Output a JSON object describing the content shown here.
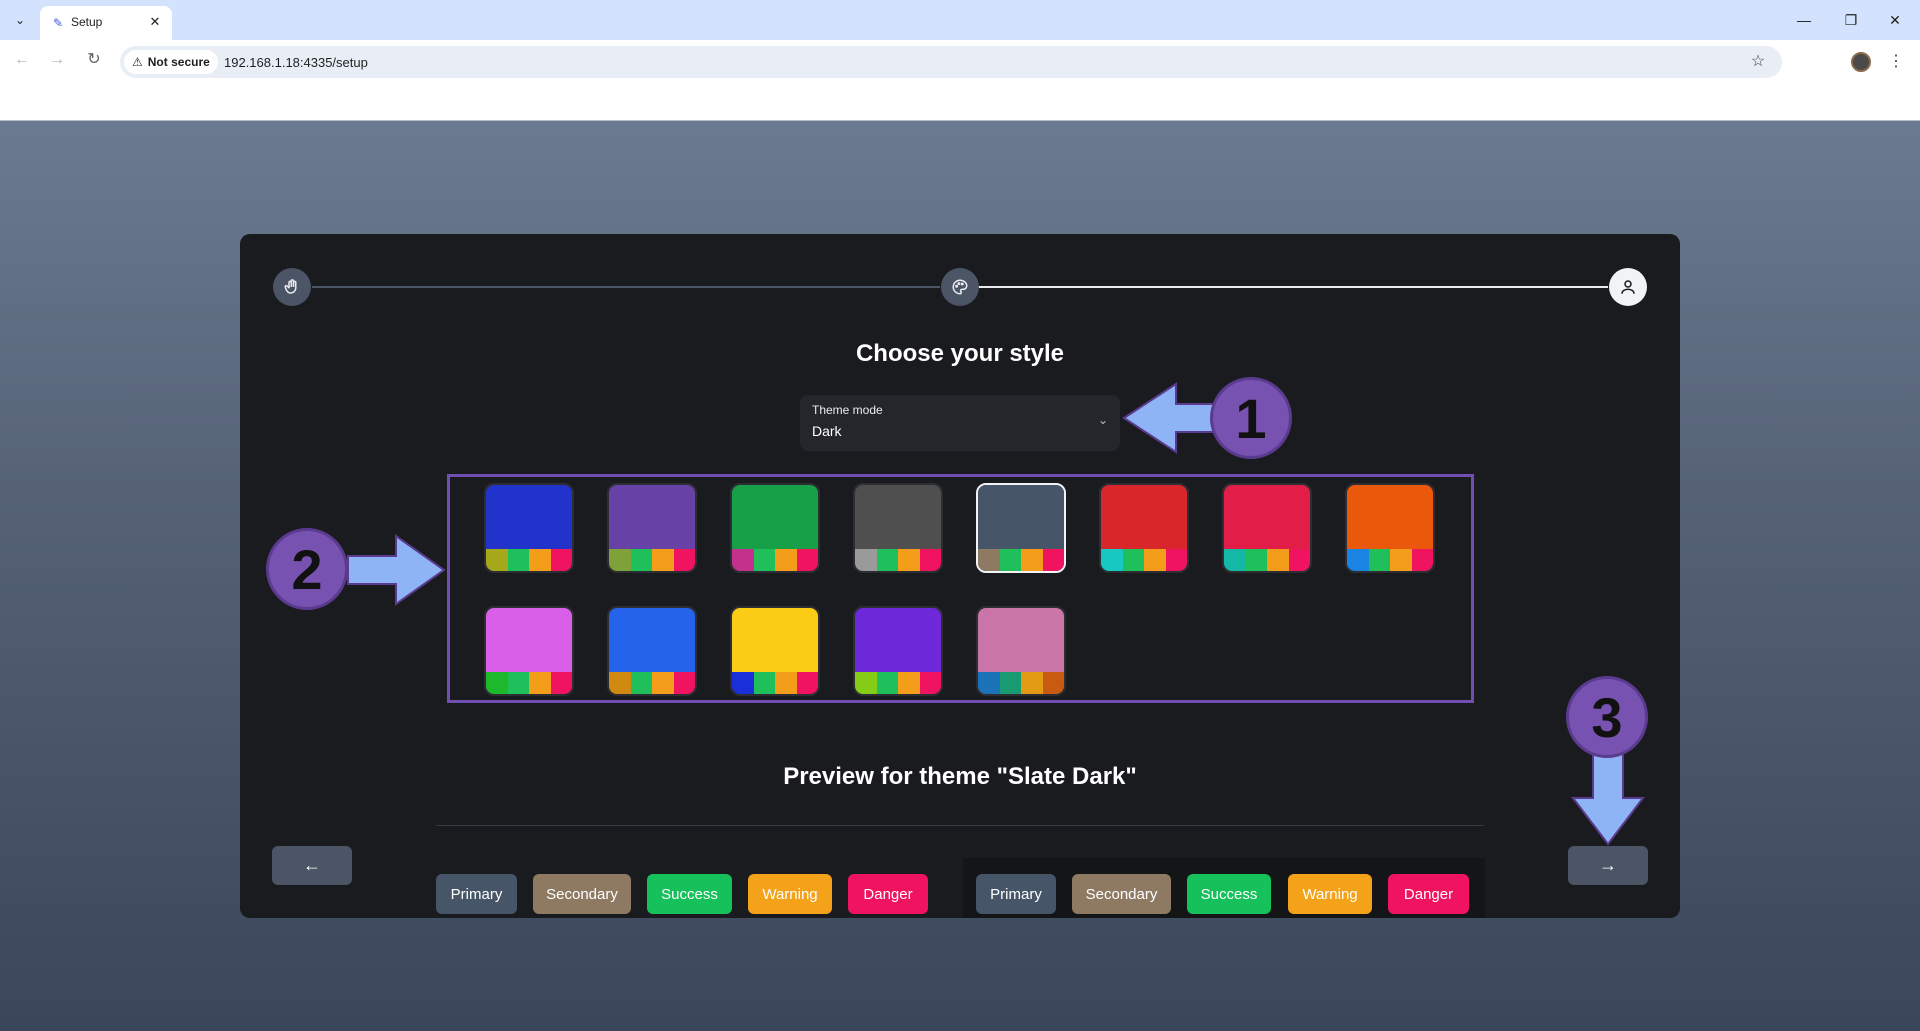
{
  "browser": {
    "tab_title": "Setup",
    "tab_close": "✕",
    "security_label": "Not secure",
    "url": "192.168.1.18:4335/setup",
    "window_controls": {
      "minimize": "—",
      "restore": "❐",
      "close": "✕"
    }
  },
  "page": {
    "title": "Choose your style",
    "theme_select": {
      "label": "Theme mode",
      "value": "Dark"
    },
    "preview_title": "Preview for theme \"Slate Dark\"",
    "back_arrow": "←",
    "next_arrow": "→",
    "steps": [
      {
        "icon": "wave-icon",
        "state": "done"
      },
      {
        "icon": "palette-icon",
        "state": "active"
      },
      {
        "icon": "user-icon",
        "state": "pending"
      }
    ],
    "swatches": [
      {
        "name": "blue-dark",
        "main": "#2233cc",
        "stripes": [
          "#a5a81a",
          "#1fbf5b",
          "#f39d1a",
          "#f0135f"
        ]
      },
      {
        "name": "violet",
        "main": "#6741a6",
        "stripes": [
          "#7ea13a",
          "#1fbf5b",
          "#f39d1a",
          "#f0135f"
        ]
      },
      {
        "name": "green",
        "main": "#18a049",
        "stripes": [
          "#c4318c",
          "#1fbf5b",
          "#f39d1a",
          "#f0135f"
        ]
      },
      {
        "name": "gray",
        "main": "#4f4f4f",
        "stripes": [
          "#9a9a9a",
          "#1fbf5b",
          "#f39d1a",
          "#f0135f"
        ]
      },
      {
        "name": "slate",
        "main": "#475569",
        "stripes": [
          "#8e7a62",
          "#1fbf5b",
          "#f39d1a",
          "#f0135f"
        ],
        "selected": true
      },
      {
        "name": "red",
        "main": "#d9262a",
        "stripes": [
          "#16c7c2",
          "#1fbf5b",
          "#f39d1a",
          "#f0135f"
        ]
      },
      {
        "name": "crimson",
        "main": "#e11d48",
        "stripes": [
          "#14b8a6",
          "#1fbf5b",
          "#f39d1a",
          "#f0135f"
        ]
      },
      {
        "name": "orange",
        "main": "#ea580c",
        "stripes": [
          "#1b84e3",
          "#1fbf5b",
          "#f39d1a",
          "#f0135f"
        ]
      },
      {
        "name": "fuchsia",
        "main": "#d95ee8",
        "stripes": [
          "#1eb82c",
          "#1fbf5b",
          "#f39d1a",
          "#f0135f"
        ]
      },
      {
        "name": "blue",
        "main": "#2563eb",
        "stripes": [
          "#d08a12",
          "#1fbf5b",
          "#f39d1a",
          "#f0135f"
        ]
      },
      {
        "name": "yellow",
        "main": "#facc15",
        "stripes": [
          "#1b2fd8",
          "#1fbf5b",
          "#f39d1a",
          "#f0135f"
        ]
      },
      {
        "name": "purple",
        "main": "#6d28d9",
        "stripes": [
          "#84cc16",
          "#1fbf5b",
          "#f39d1a",
          "#f0135f"
        ]
      },
      {
        "name": "pink",
        "main": "#c975a8",
        "stripes": [
          "#1d73b8",
          "#1a9a70",
          "#e39b16",
          "#c95a12"
        ]
      }
    ],
    "preview_light_buttons": [
      {
        "label": "Primary",
        "color": "#475569"
      },
      {
        "label": "Secondary",
        "color": "#8e7a62"
      },
      {
        "label": "Success",
        "color": "#16c15b"
      },
      {
        "label": "Warning",
        "color": "#f5a21b"
      },
      {
        "label": "Danger",
        "color": "#f0135f"
      }
    ],
    "preview_dark_buttons": [
      {
        "label": "Primary",
        "color": "#475569"
      },
      {
        "label": "Secondary",
        "color": "#8e7a62"
      },
      {
        "label": "Success",
        "color": "#16c15b"
      },
      {
        "label": "Warning",
        "color": "#f5a21b"
      },
      {
        "label": "Danger",
        "color": "#f0135f"
      }
    ]
  },
  "annotations": {
    "badge_1": "1",
    "badge_2": "2",
    "badge_3": "3",
    "accent": "#7a5bb5",
    "arrow_color": "#8fb4f5"
  }
}
